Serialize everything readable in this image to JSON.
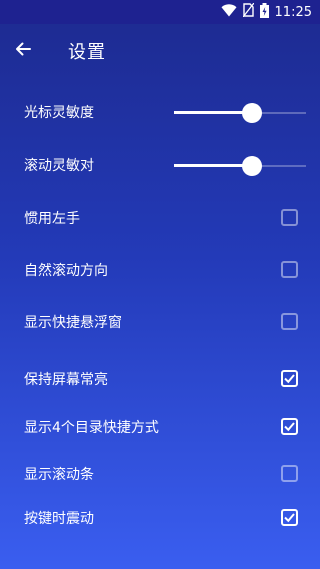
{
  "status_bar": {
    "time": "11:25",
    "icons": [
      "wifi-icon",
      "no-sim-icon",
      "battery-charging-icon"
    ]
  },
  "header": {
    "back_icon": "arrow-left-icon",
    "title": "设置"
  },
  "settings": {
    "sliders": [
      {
        "label": "光标灵敏度",
        "value_fraction": 0.59
      },
      {
        "label": "滚动灵敏对",
        "value_fraction": 0.59
      }
    ],
    "options": [
      {
        "label": "惯用左手",
        "checked": false
      },
      {
        "label": "自然滚动方向",
        "checked": false
      },
      {
        "label": "显示快捷悬浮窗",
        "checked": false
      },
      {
        "label": "保持屏幕常亮",
        "checked": true
      },
      {
        "label": "显示4个目录快捷方式",
        "checked": true
      },
      {
        "label": "显示滚动条",
        "checked": false
      },
      {
        "label": "按键时震动",
        "checked": true
      }
    ]
  },
  "colors": {
    "background_top": "#1d2a8f",
    "background_bottom": "#3a5ef0",
    "status_bar": "#1e2290",
    "foreground": "#ffffff"
  }
}
